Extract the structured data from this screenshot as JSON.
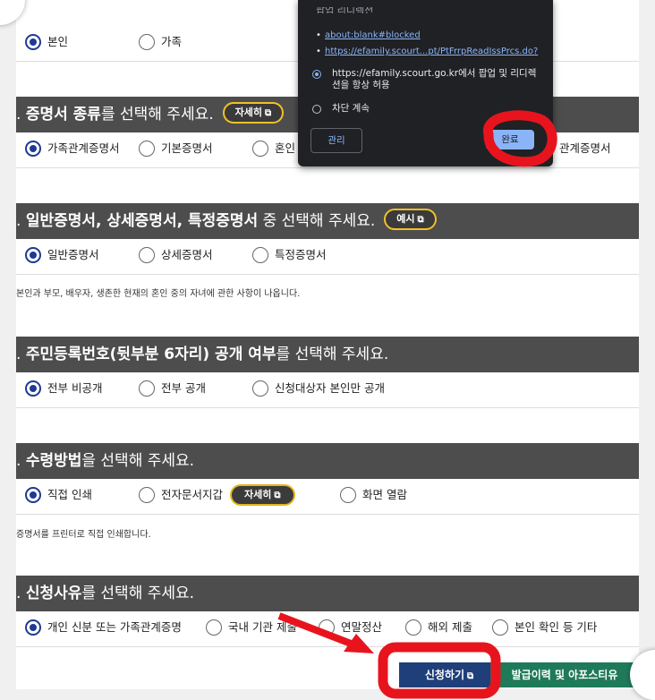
{
  "applicant_row": {
    "options": [
      "본인",
      "가족"
    ],
    "selected": 0
  },
  "cert_type": {
    "prefix": ". ",
    "bold": "증명서 종류",
    "rest": "를 선택해 주세요.",
    "button": "자세히",
    "options": [
      "가족관계증명서",
      "기본증명서",
      "혼인",
      "관계증명서"
    ]
  },
  "cert_detail": {
    "prefix": ". ",
    "bold": "일반증명서, 상세증명서, 특정증명서",
    "rest": " 중 선택해 주세요.",
    "button": "예시",
    "options": [
      "일반증명서",
      "상세증명서",
      "특정증명서"
    ],
    "note": "본인과 부모, 배우자, 생존한 현재의 혼인 중의 자녀에 관한 사항이 나옵니다."
  },
  "rrn": {
    "prefix": ". ",
    "bold": "주민등록번호(뒷부분 6자리) 공개 여부",
    "rest": "를 선택해 주세요.",
    "options": [
      "전부 비공개",
      "전부 공개",
      "신청대상자 본인만 공개"
    ]
  },
  "receive": {
    "prefix": ". ",
    "bold": "수령방법",
    "rest": "을 선택해 주세요.",
    "options": [
      "직접 인쇄",
      "전자문서지갑",
      "화면 열람"
    ],
    "inline_button": "자세히",
    "note": "증명서를 프린터로 직접 인쇄합니다."
  },
  "reason": {
    "prefix": ". ",
    "bold": "신청사유",
    "rest": "를 선택해 주세요.",
    "options": [
      "개인 신분 또는 가족관계증명",
      "국내 기관 제출",
      "연말정산",
      "해외 제출",
      "본인 확인 등 기타"
    ]
  },
  "buttons": {
    "apply": "신청하기",
    "history": "발급이력 및 아포스티유"
  },
  "popup": {
    "title": "팝업 리디렉션",
    "links": [
      "about:blank#blocked",
      "https://efamily.scourt...pt/PtFrrpReadIssPrcs.do?"
    ],
    "allow_text": "https://efamily.scourt.go.kr에서 팝업 및 리디렉션을 항상 허용",
    "block_text": "차단 계속",
    "manage": "관리",
    "done": "완료"
  },
  "colors": {
    "header_bg": "#4d4d4d",
    "accent_yellow": "#f2c029",
    "radio_blue": "#1f3a93",
    "apply_bg": "#1e3f7a",
    "history_bg": "#1f7a5a",
    "annotation_red": "#e8141d"
  }
}
